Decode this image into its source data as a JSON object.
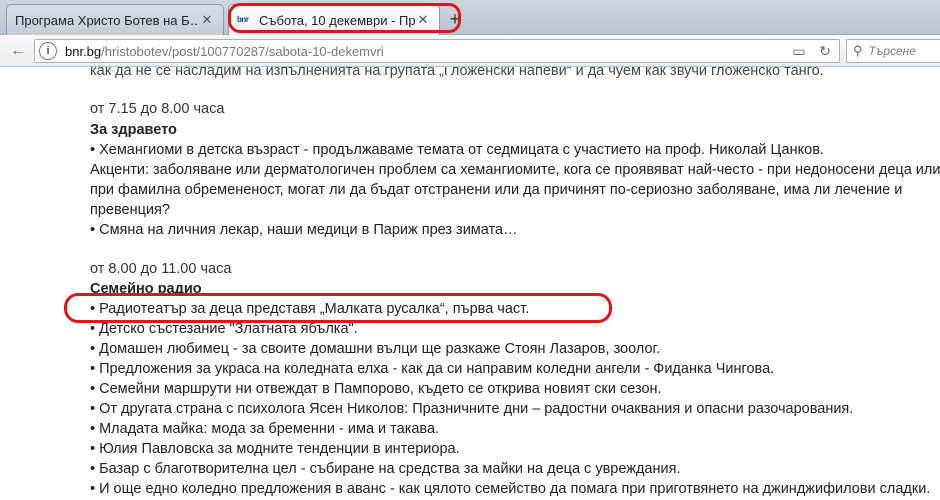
{
  "browser": {
    "tabs": [
      {
        "title": "Програма Христо Ботев на Б…",
        "close": "✕"
      },
      {
        "title": "Събота, 10 декември - Пр…",
        "close": "✕",
        "favicon": "bnr"
      }
    ],
    "new_tab": "+",
    "url_host": "bnr.bg",
    "url_path": "/hristobotev/post/100770287/sabota-10-dekemvri",
    "search_placeholder": "Търсене",
    "highlight_color": "#e0141b"
  },
  "article": {
    "cut_line": "как да не се насладим на изпълненията на групата „Гложенски напеви“ и да чуем как звучи гложенско танго.",
    "s1_time": "от 7.15 до 8.00 часа",
    "s1_heading": "За здравето",
    "s1_l1": "• Хемангиоми в детска възраст - продължаваме темата от седмицата с участието на проф. Николай Цанков.",
    "s1_l2": "Акценти: заболяване или дерматологичен проблем са хемангиомите, кога се проявяват най-често - при недоносени деца или",
    "s1_l3": "при фамилна обремененост, могат ли да бъдат отстранени или да причинят по-сериозно заболяване, има ли лечение и",
    "s1_l4": "превенция?",
    "s1_l5": "• Смяна на личния лекар, наши медици в Париж през зимата…",
    "s2_time": "от 8.00 до 11.00 часа",
    "s2_heading": "Семейно радио",
    "items": [
      "• Радиотеатър за деца представя „Малката русалка“, първа част.",
      "• Детско състезание \"Златната ябълка\".",
      "• Домашен любимец - за своите домашни вълци ще разкаже Стоян Лазаров, зоолог.",
      "• Предложения за украса на коледната елха - как да си направим коледни ангели - Фиданка Чингова.",
      "• Семейни маршрути ни отвеждат в Пампорово, където се открива новият ски сезон.",
      "• От другата страна с психолога Ясен Николов: Празничните дни – радостни очаквания и опасни разочарования.",
      "• Младата майка: мода за бременни - има и такава.",
      "• Юлия Павловска за модните тенденции в интериора.",
      "• Базар с благотворителна цел - събиране на средства за майки на деца с увреждания.",
      "• И още едно коледно предложения в аванс - как цялото семейство да помага при приготвянето на джинджифилови сладки."
    ]
  }
}
